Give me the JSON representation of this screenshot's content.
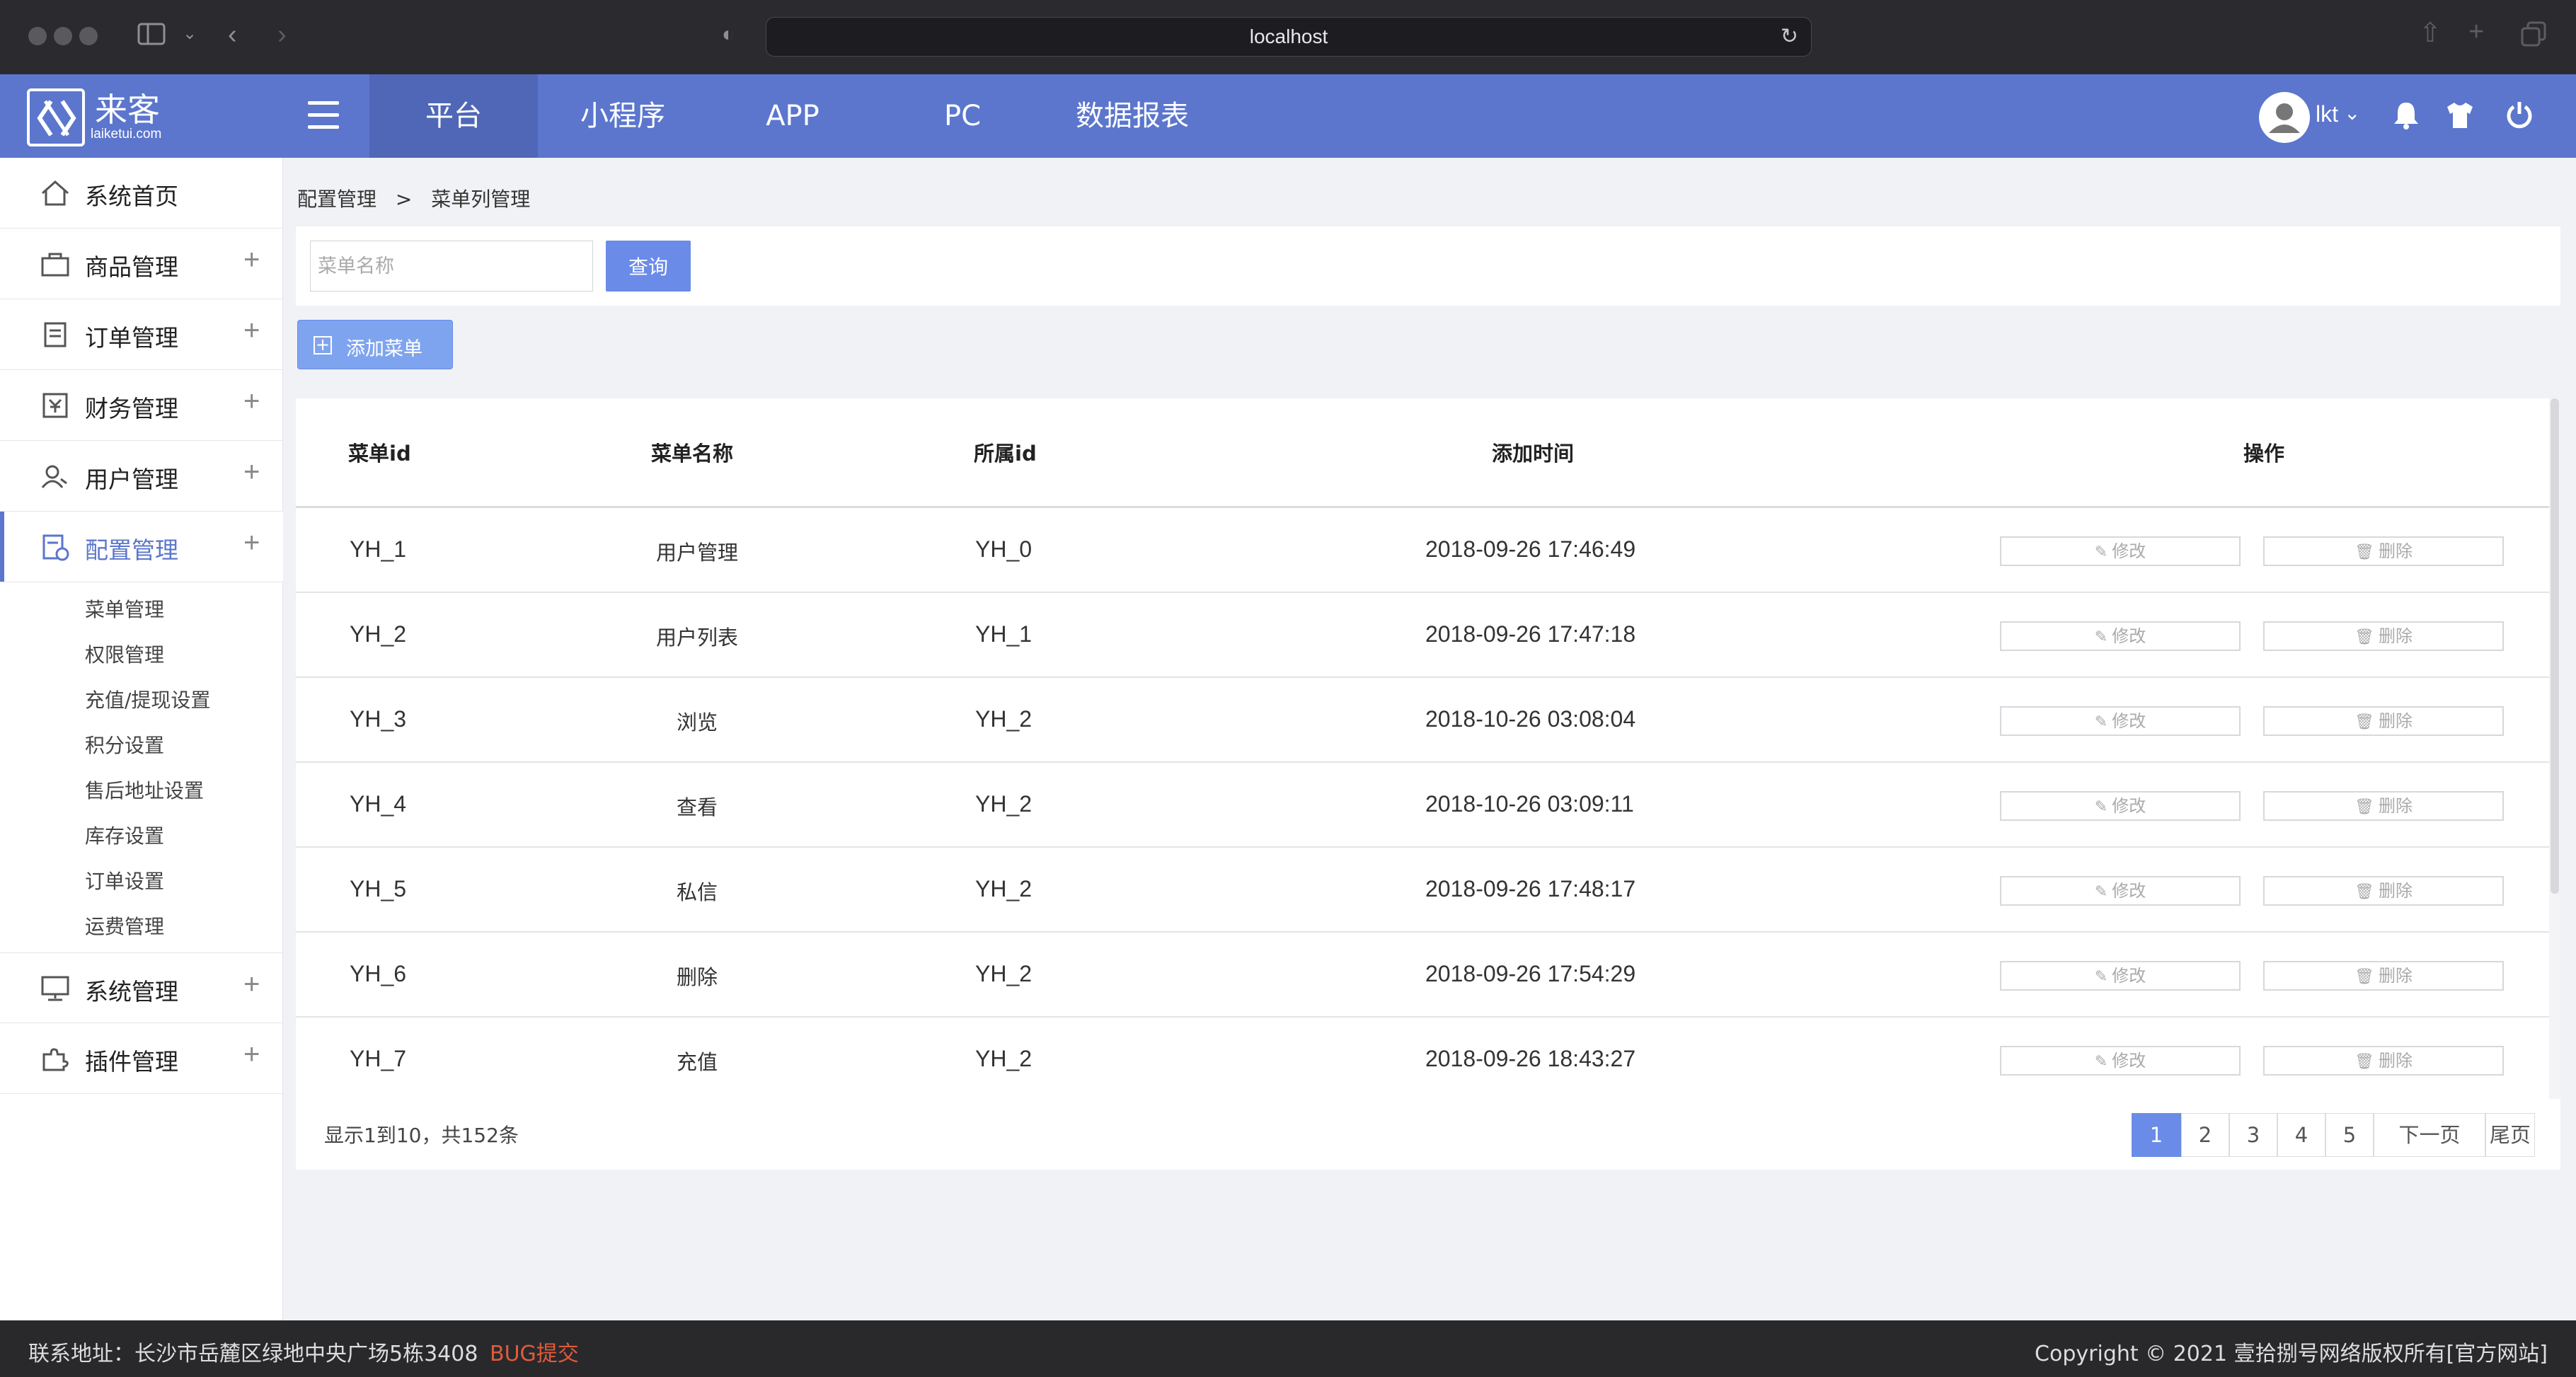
{
  "browser": {
    "url": "localhost"
  },
  "topnav": {
    "logo_text": "来客",
    "logo_sub": "laiketui.com",
    "tabs": [
      {
        "label": "平台",
        "active": true
      },
      {
        "label": "小程序",
        "active": false
      },
      {
        "label": "APP",
        "active": false
      },
      {
        "label": "PC",
        "active": false
      },
      {
        "label": "数据报表",
        "active": false
      }
    ],
    "user_name": "lkt",
    "colors": {
      "nav_bg": "#5b76cc",
      "accent": "#6a8ce8"
    }
  },
  "sidebar": {
    "items": [
      {
        "label": "系统首页",
        "icon": "home-icon"
      },
      {
        "label": "商品管理",
        "icon": "bag-icon",
        "plus": "+"
      },
      {
        "label": "订单管理",
        "icon": "clipboard-icon",
        "plus": "+"
      },
      {
        "label": "财务管理",
        "icon": "finance-icon",
        "plus": "+"
      },
      {
        "label": "用户管理",
        "icon": "users-icon",
        "plus": "+"
      },
      {
        "label": "配置管理",
        "icon": "config-icon",
        "plus": "+",
        "active": true
      },
      {
        "label": "系统管理",
        "icon": "monitor-icon",
        "plus": "+"
      },
      {
        "label": "插件管理",
        "icon": "puzzle-icon",
        "plus": "+"
      }
    ],
    "sub_items": [
      "菜单管理",
      "权限管理",
      "充值/提现设置",
      "积分设置",
      "售后地址设置",
      "库存设置",
      "订单设置",
      "运费管理"
    ]
  },
  "breadcrumb": {
    "root": "配置管理",
    "sep": ">",
    "current": "菜单列管理"
  },
  "search": {
    "placeholder": "菜单名称",
    "button": "查询"
  },
  "add_button": "添加菜单",
  "table": {
    "headers": [
      "菜单id",
      "菜单名称",
      "所属id",
      "添加时间",
      "操作"
    ],
    "edit_label": "修改",
    "delete_label": "删除",
    "rows": [
      {
        "id": "YH_1",
        "name": "用户管理",
        "parent": "YH_0",
        "time": "2018-09-26 17:46:49"
      },
      {
        "id": "YH_2",
        "name": "用户列表",
        "parent": "YH_1",
        "time": "2018-09-26 17:47:18"
      },
      {
        "id": "YH_3",
        "name": "浏览",
        "parent": "YH_2",
        "time": "2018-10-26 03:08:04"
      },
      {
        "id": "YH_4",
        "name": "查看",
        "parent": "YH_2",
        "time": "2018-10-26 03:09:11"
      },
      {
        "id": "YH_5",
        "name": "私信",
        "parent": "YH_2",
        "time": "2018-09-26 17:48:17"
      },
      {
        "id": "YH_6",
        "name": "删除",
        "parent": "YH_2",
        "time": "2018-09-26 17:54:29"
      },
      {
        "id": "YH_7",
        "name": "充值",
        "parent": "YH_2",
        "time": "2018-09-26 18:43:27"
      }
    ]
  },
  "pager": {
    "summary": "显示1到10，共152条",
    "pages": [
      "1",
      "2",
      "3",
      "4",
      "5"
    ],
    "current": "1",
    "next": "下一页",
    "last": "尾页"
  },
  "footer": {
    "address": "联系地址：长沙市岳麓区绿地中央广场5栋3408",
    "bug": "BUG提交",
    "copyright": "Copyright © 2021 壹拾捌号网络版权所有[官方网站]"
  }
}
